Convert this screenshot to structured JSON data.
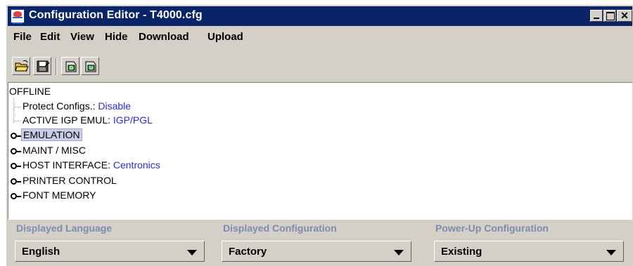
{
  "window": {
    "title": "Configuration Editor - T4000.cfg",
    "title_bar_color": "#0a246a"
  },
  "menu": {
    "items": [
      "File",
      "Edit",
      "View",
      "Hide",
      "Download",
      "Upload"
    ]
  },
  "toolbar": {
    "buttons": [
      "open-folder-icon",
      "save-disk-icon",
      "download-printer-icon",
      "upload-printer-icon"
    ]
  },
  "tree": {
    "root": "OFFLINE",
    "leaves": [
      {
        "label": "Protect Configs.: ",
        "value": "Disable"
      },
      {
        "label": "ACTIVE IGP EMUL: ",
        "value": "IGP/PGL"
      }
    ],
    "nodes": [
      {
        "label": "EMULATION",
        "value": "",
        "selected": true
      },
      {
        "label": "MAINT / MISC",
        "value": ""
      },
      {
        "label": "HOST INTERFACE: ",
        "value": "Centronics"
      },
      {
        "label": "PRINTER CONTROL",
        "value": ""
      },
      {
        "label": "FONT MEMORY",
        "value": ""
      }
    ],
    "value_color": "#2b2bd6"
  },
  "bottom": {
    "displayed_language": {
      "label": "Displayed Language",
      "value": "English"
    },
    "displayed_configuration": {
      "label": "Displayed Configuration",
      "value": "Factory"
    },
    "powerup_configuration": {
      "label": "Power-Up Configuration",
      "value": "Existing"
    },
    "label_color": "#7e8ab0"
  }
}
